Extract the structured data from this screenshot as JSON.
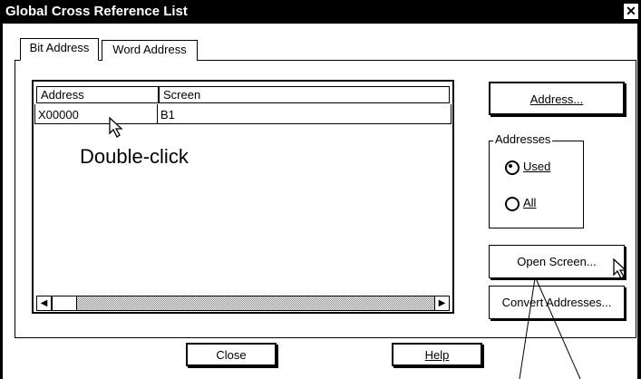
{
  "window": {
    "title": "Global Cross Reference List",
    "close_glyph": "✕"
  },
  "tabs": [
    {
      "label": "Bit Address",
      "selected": true
    },
    {
      "label": "Word Address",
      "selected": false
    }
  ],
  "list": {
    "columns": [
      "Address",
      "Screen"
    ],
    "rows": [
      {
        "address": "X00000",
        "screen": "B1"
      }
    ]
  },
  "annotation": "Double-click",
  "buttons": {
    "address": "Address...",
    "open_screen": "Open Screen...",
    "convert_addresses": "Convert Addresses...",
    "close": "Close",
    "help": "Help"
  },
  "addresses_group": {
    "label": "Addresses",
    "options": [
      {
        "label": "Used",
        "selected": true
      },
      {
        "label": "All",
        "selected": false
      }
    ]
  }
}
